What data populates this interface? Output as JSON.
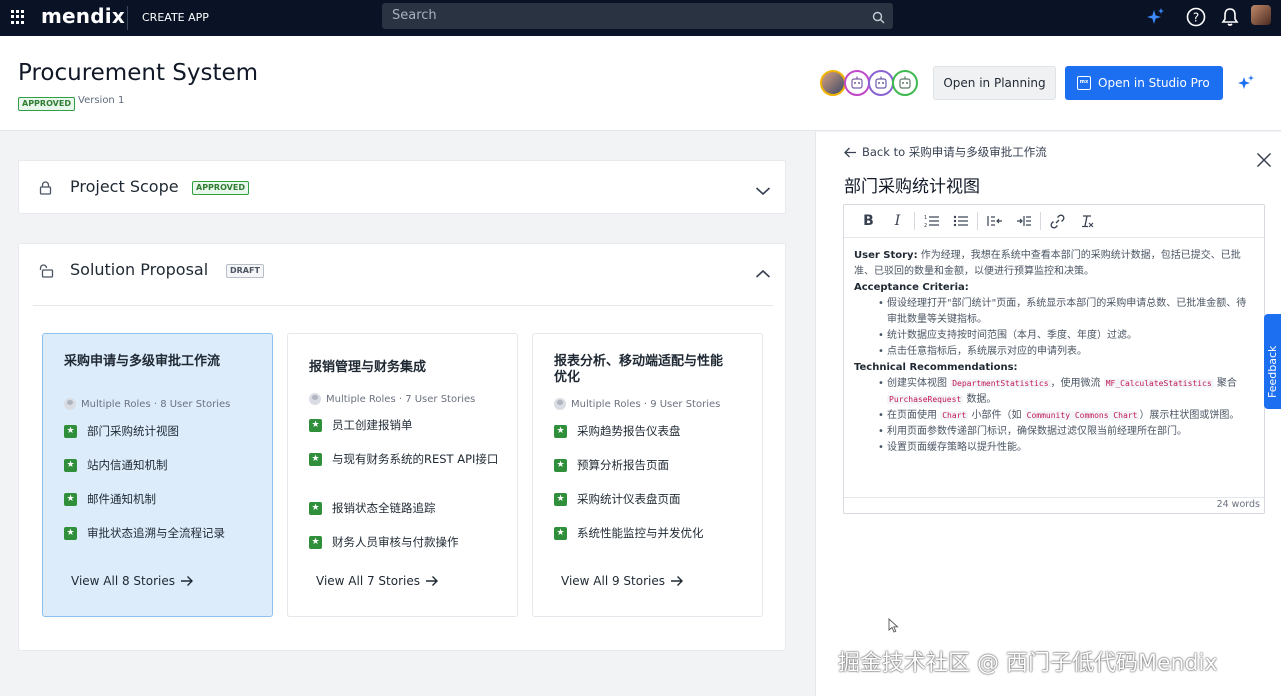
{
  "topbar": {
    "brand": "mendix",
    "create_app": "CREATE APP",
    "search_placeholder": "Search"
  },
  "header": {
    "title": "Procurement System",
    "status_badge": "APPROVED",
    "version": "Version 1",
    "open_planning": "Open in Planning",
    "open_studio": "Open in Studio Pro",
    "studio_icon_text": "mx"
  },
  "sections": {
    "scope": {
      "title": "Project Scope",
      "badge": "APPROVED"
    },
    "proposal": {
      "title": "Solution Proposal",
      "badge": "DRAFT"
    }
  },
  "features": [
    {
      "title": "采购申请与多级审批工作流",
      "meta": "Multiple Roles · 8 User Stories",
      "stories": [
        "部门采购统计视图",
        "站内信通知机制",
        "邮件通知机制",
        "审批状态追溯与全流程记录"
      ],
      "view_all": "View All 8 Stories"
    },
    {
      "title": "报销管理与财务集成",
      "meta": "Multiple Roles · 7 User Stories",
      "stories": [
        "员工创建报销单",
        "与现有财务系统的REST API接口",
        "报销状态全链路追踪",
        "财务人员审核与付款操作"
      ],
      "view_all": "View All 7 Stories"
    },
    {
      "title": "报表分析、移动端适配与性能优化",
      "meta": "Multiple Roles · 9 User Stories",
      "stories": [
        "采购趋势报告仪表盘",
        "预算分析报告页面",
        "采购统计仪表盘页面",
        "系统性能监控与并发优化"
      ],
      "view_all": "View All 9 Stories"
    }
  ],
  "detail": {
    "back": "Back to 采购申请与多级审批工作流",
    "title": "部门采购统计视图",
    "user_story_label": "User Story:",
    "user_story": "作为经理，我想在系统中查看本部门的采购统计数据，包括已提交、已批准、已驳回的数量和金额，以便进行预算监控和决策。",
    "acceptance_label": "Acceptance Criteria:",
    "acceptance": [
      "假设经理打开\"部门统计\"页面，系统显示本部门的采购申请总数、已批准金额、待审批数量等关键指标。",
      "统计数据应支持按时间范围（本月、季度、年度）过滤。",
      "点击任意指标后，系统展示对应的申请列表。"
    ],
    "tech_label": "Technical Recommendations:",
    "tech": {
      "r1_a": "创建实体视图",
      "r1_code1": "DepartmentStatistics",
      "r1_b": "，使用微流",
      "r1_code2": "MF_CalculateStatistics",
      "r1_c": "聚合",
      "r1_code3": "PurchaseRequest",
      "r1_d": "数据。",
      "r2_a": "在页面使用",
      "r2_code1": "Chart",
      "r2_b": "小部件（如",
      "r2_code2": "Community Commons Chart",
      "r2_c": "）展示柱状图或饼图。",
      "r3": "利用页面参数传递部门标识，确保数据过滤仅限当前经理所在部门。",
      "r4": "设置页面缓存策略以提升性能。"
    },
    "word_count": "24 words"
  },
  "feedback": "Feedback",
  "watermark": "掘金技术社区 @ 西门子低代码Mendix"
}
